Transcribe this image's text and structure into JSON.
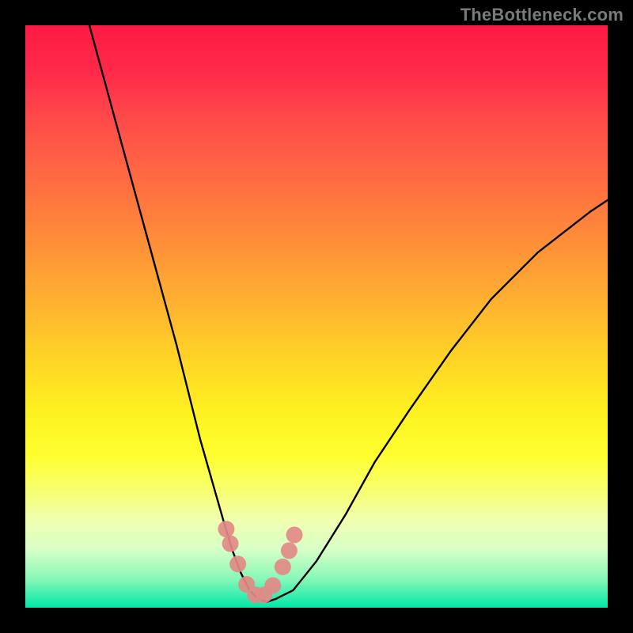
{
  "attribution": "TheBottleneck.com",
  "chart_data": {
    "type": "line",
    "title": "",
    "xlabel": "",
    "ylabel": "",
    "xlim": [
      0,
      100
    ],
    "ylim": [
      0,
      100
    ],
    "series": [
      {
        "name": "bottleneck-curve",
        "x": [
          11,
          14,
          17,
          20,
          23,
          26,
          28,
          30,
          32,
          34,
          35.5,
          37,
          38.5,
          40,
          41.5,
          43,
          46,
          50,
          55,
          60,
          66,
          73,
          80,
          88,
          97,
          100
        ],
        "y": [
          100,
          89,
          78,
          67,
          56,
          45,
          37,
          29,
          22,
          15,
          10,
          6,
          3,
          1.5,
          1,
          1.5,
          3,
          8,
          16,
          25,
          34,
          44,
          53,
          61,
          68,
          70
        ]
      }
    ],
    "markers": {
      "name": "curve-points",
      "x": [
        34.5,
        35.2,
        36.5,
        38,
        39.5,
        41,
        42.5,
        44.2,
        45.3,
        46.2
      ],
      "y": [
        13.5,
        11,
        7.5,
        4,
        2.2,
        2.2,
        3.8,
        7,
        9.8,
        12.5
      ]
    }
  }
}
